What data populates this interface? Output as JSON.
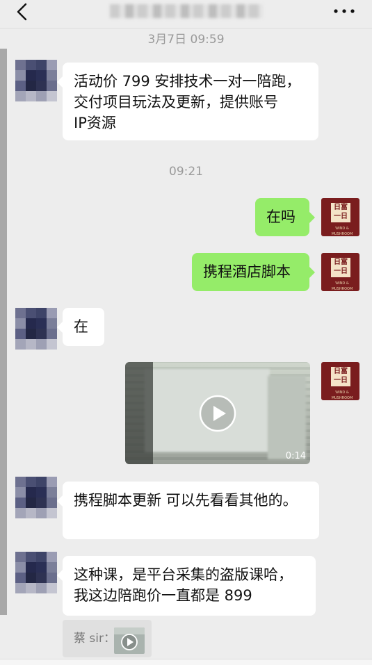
{
  "header": {
    "title_obscured": true,
    "back_icon": "chevron-left-icon",
    "more_icon": "more-dots-icon"
  },
  "messages": [
    {
      "type": "time",
      "text": "3月7日 09:59"
    },
    {
      "type": "text",
      "side": "left",
      "text_lines": [
        "活动价 799 安排技术一对一陪跑，",
        "交付项目玩法及更新，提供账号",
        "IP资源"
      ]
    },
    {
      "type": "time",
      "text": "09:21"
    },
    {
      "type": "text",
      "side": "right",
      "text": "在吗"
    },
    {
      "type": "text",
      "side": "right",
      "text": "携程酒店脚本"
    },
    {
      "type": "text",
      "side": "left",
      "text": "在"
    },
    {
      "type": "video",
      "side": "right",
      "duration": "0:14"
    },
    {
      "type": "text",
      "side": "left",
      "text": "携程脚本更新 可以先看看其他的。"
    },
    {
      "type": "text",
      "side": "left",
      "text_lines": [
        "这种课，是平台采集的盗版课哈，",
        "我这边陪跑价一直都是 899"
      ]
    },
    {
      "type": "quote",
      "label": "蔡 sir："
    }
  ],
  "my_avatar": {
    "line1": "日富",
    "line2": "一日",
    "subtitle": "WIND & MUSHROOM"
  },
  "colors": {
    "background": "#ededed",
    "my_bubble": "#95ec69",
    "their_bubble": "#ffffff",
    "time_text": "#9a9a9a"
  }
}
